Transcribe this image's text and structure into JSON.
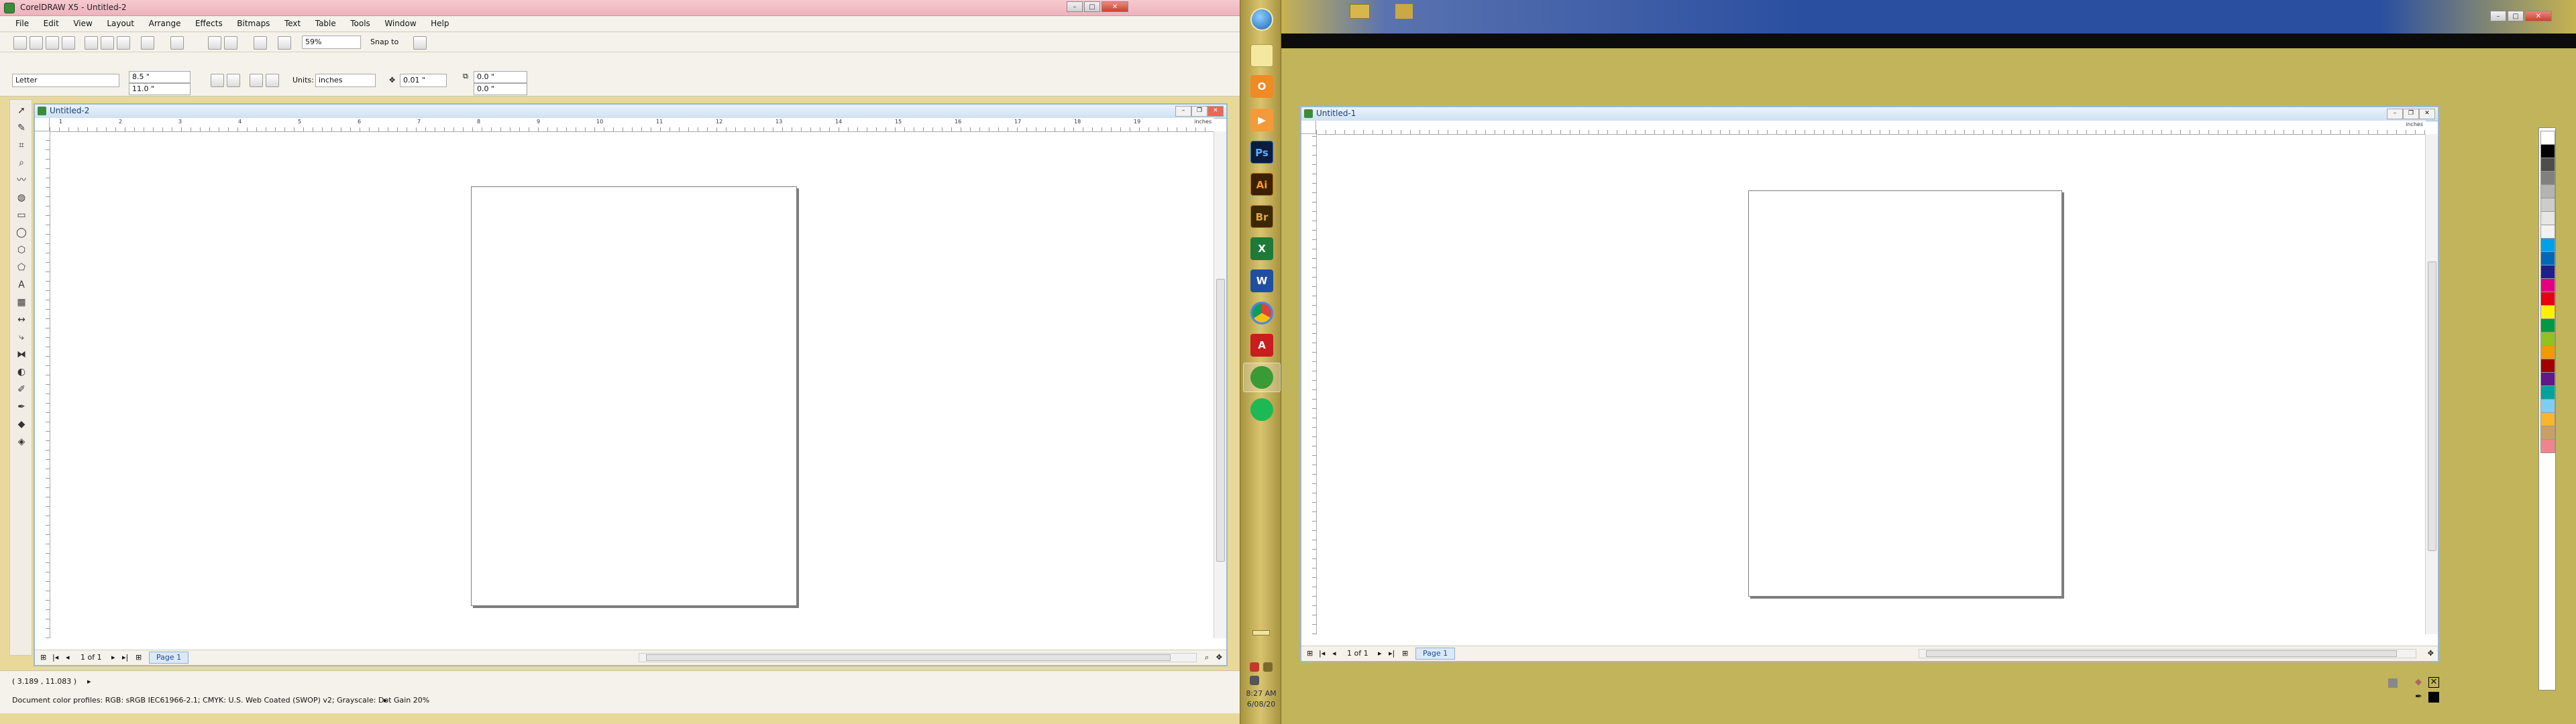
{
  "left_window": {
    "title": "CorelDRAW X5 - Untitled-2",
    "caption_buttons": [
      "–",
      "□",
      "✕"
    ],
    "menu": [
      "File",
      "Edit",
      "View",
      "Layout",
      "Arrange",
      "Effects",
      "Bitmaps",
      "Text",
      "Table",
      "Tools",
      "Window",
      "Help"
    ],
    "standard_toolbar": {
      "zoom_value": "59%",
      "snap_to_label": "Snap to"
    },
    "property_bar": {
      "paper_size": "Letter",
      "width_value": "8.5 \"",
      "height_value": "11.0 \"",
      "units_label": "Units:",
      "units_value": "inches",
      "nudge_value": "0.01 \"",
      "dup_x_value": "0.0 \"",
      "dup_y_value": "0.0 \""
    },
    "document": {
      "title": "Untitled-2",
      "ruler_units": "inches",
      "ruler_labels": [
        "1",
        "2",
        "3",
        "4",
        "5",
        "6",
        "7",
        "8",
        "9",
        "10",
        "11",
        "12",
        "13",
        "14",
        "15",
        "16",
        "17",
        "18",
        "19"
      ],
      "page_counter": "1 of 1",
      "page_tab": "Page 1"
    },
    "status": {
      "cursor_position": "( 3.189 , 11.083 )",
      "color_profiles": "Document color profiles: RGB: sRGB IEC61966-2.1; CMYK: U.S. Web Coated (SWOP) v2; Grayscale: Dot Gain 20%"
    }
  },
  "taskbar": {
    "apps": [
      {
        "icon": "windows-orb-icon",
        "label": ""
      },
      {
        "icon": "notes-icon",
        "label": ""
      },
      {
        "icon": "outlook-icon",
        "label": "O"
      },
      {
        "icon": "media-player-icon",
        "label": "▶"
      },
      {
        "icon": "photoshop-icon",
        "label": "Ps"
      },
      {
        "icon": "illustrator-icon",
        "label": "Ai"
      },
      {
        "icon": "bridge-icon",
        "label": "Br"
      },
      {
        "icon": "excel-icon",
        "label": "X"
      },
      {
        "icon": "word-icon",
        "label": "W"
      },
      {
        "icon": "chrome-icon",
        "label": ""
      },
      {
        "icon": "acrobat-icon",
        "label": "A"
      },
      {
        "icon": "coreldraw-icon",
        "label": ""
      },
      {
        "icon": "spotify-icon",
        "label": ""
      }
    ],
    "clock_time": "8:27 AM",
    "clock_date": "6/08/20"
  },
  "right_window": {
    "document": {
      "title": "Untitled-1",
      "ruler_units": "inches",
      "page_counter": "1 of 1",
      "page_tab": "Page 1"
    },
    "palette_colors": [
      "#ffffff",
      "#000000",
      "#4d4d4d",
      "#808080",
      "#b3b3b3",
      "#cccccc",
      "#e6e6e6",
      "#f2f2f2",
      "#00a0e9",
      "#0068b7",
      "#1d2088",
      "#e4007f",
      "#e60012",
      "#fff100",
      "#009944",
      "#8fc31f",
      "#f39800",
      "#a40000",
      "#601986",
      "#00a29a",
      "#7ecef4",
      "#f8b62d",
      "#c9a063",
      "#ef858c"
    ]
  }
}
